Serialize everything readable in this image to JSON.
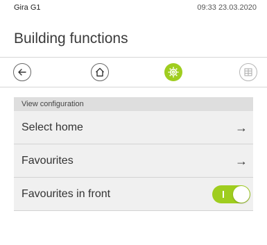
{
  "status": {
    "device": "Gira G1",
    "datetime": "09:33 23.03.2020"
  },
  "page": {
    "title": "Building functions"
  },
  "nav": {
    "items": [
      {
        "icon": "back-arrow-icon"
      },
      {
        "icon": "home-icon"
      },
      {
        "icon": "settings-gear-icon",
        "active": true,
        "accent": "#9fcd1f"
      },
      {
        "icon": "grid-icon",
        "disabled": true
      }
    ]
  },
  "section": {
    "header": "View configuration",
    "rows": [
      {
        "label": "Select home",
        "icon": "right-arrow-icon"
      },
      {
        "label": "Favourites",
        "icon": "right-arrow-icon"
      },
      {
        "label": "Favourites in front",
        "toggle": true,
        "toggle_color": "#9fcd1f"
      }
    ]
  }
}
